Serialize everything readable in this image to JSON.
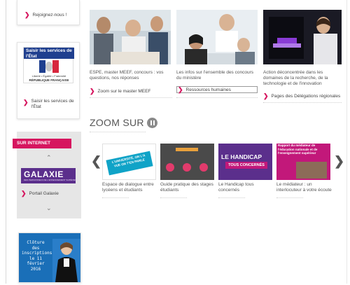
{
  "sidebar": {
    "join_label": "Rejoignez-nous !",
    "services_banner": {
      "title": "Saisir les services de l'État",
      "motto": "Liberté • Égalité • Fraternité",
      "republic": "RÉPUBLIQUE FRANÇAISE"
    },
    "services_link": "Saisir les services de l'État",
    "internet_header": "SUR INTERNET",
    "galaxie_logo": "GALAXIE",
    "galaxie_sub": "DES PERSONNELS DE L'ENSEIGNEMENT SUPÉRIEUR",
    "galaxie_link": "Portail Galaxie",
    "poster_text": [
      "Clôture",
      "des",
      "inscriptions",
      "le 11",
      "février",
      "2016"
    ]
  },
  "news": [
    {
      "caption": "ESPE, master MEEF, concours : vos questions, nos réponses",
      "link": "Zoom sur le master MEEF"
    },
    {
      "caption": "Les infos sur l'ensemble des concours du ministère",
      "link": "Ressources humaines"
    },
    {
      "caption": "Action déconcentrée dans les domaines de la recherche, de la technologie et de l'innovation",
      "link": "Pages des Délégations régionales"
    }
  ],
  "zoom": {
    "title": "ZOOM SUR",
    "items": [
      {
        "caption": "Espace de dialogue entre lycéens et étudiants",
        "art": "L'UNIVERSITÉ, ON L'A VUE ON T'EN PARLE"
      },
      {
        "caption": "Guide pratique des stages étudiants",
        "art": ""
      },
      {
        "caption": "Le Handicap tous concernés",
        "art_line1": "LE HANDICAP",
        "art_line2": "TOUS CONCERNÉS"
      },
      {
        "caption": "Le médiateur : un interlocuteur à votre écoute",
        "art": "Rapport du médiateur de l'éducation nationale et de l'enseignement supérieur"
      }
    ]
  },
  "colors": {
    "accent": "#d6165f",
    "purple": "#5b2f8c",
    "magenta": "#c2187a"
  }
}
